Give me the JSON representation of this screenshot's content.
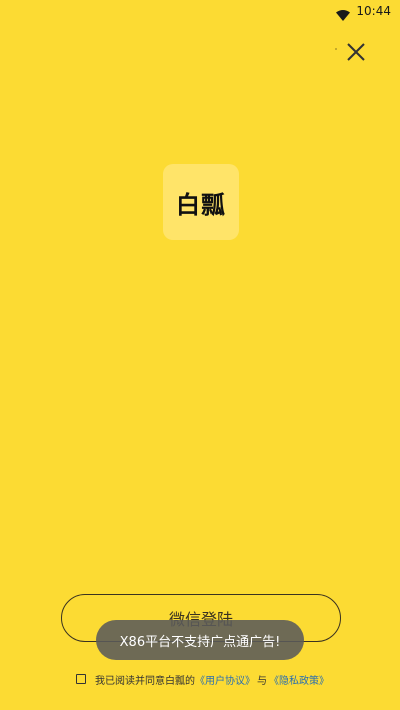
{
  "status_bar": {
    "time": "10:44",
    "icons": [
      "wifi-icon"
    ]
  },
  "top_bar": {
    "close_icon": "close-icon"
  },
  "logo": {
    "text": "白瓢",
    "background": "#FFE469"
  },
  "login": {
    "wechat_button_label": "微信登陆"
  },
  "toast": {
    "message": "X86平台不支持广点通广告!"
  },
  "agreement": {
    "checked": false,
    "prefix": "我已阅读并同意白瓢的",
    "user_agreement": "《用户协议》",
    "connector": "与",
    "privacy_policy": "《隐私政策》"
  },
  "colors": {
    "background": "#FCDB33",
    "link": "#2a6fb0",
    "toast_bg": "#5a5a5a"
  }
}
